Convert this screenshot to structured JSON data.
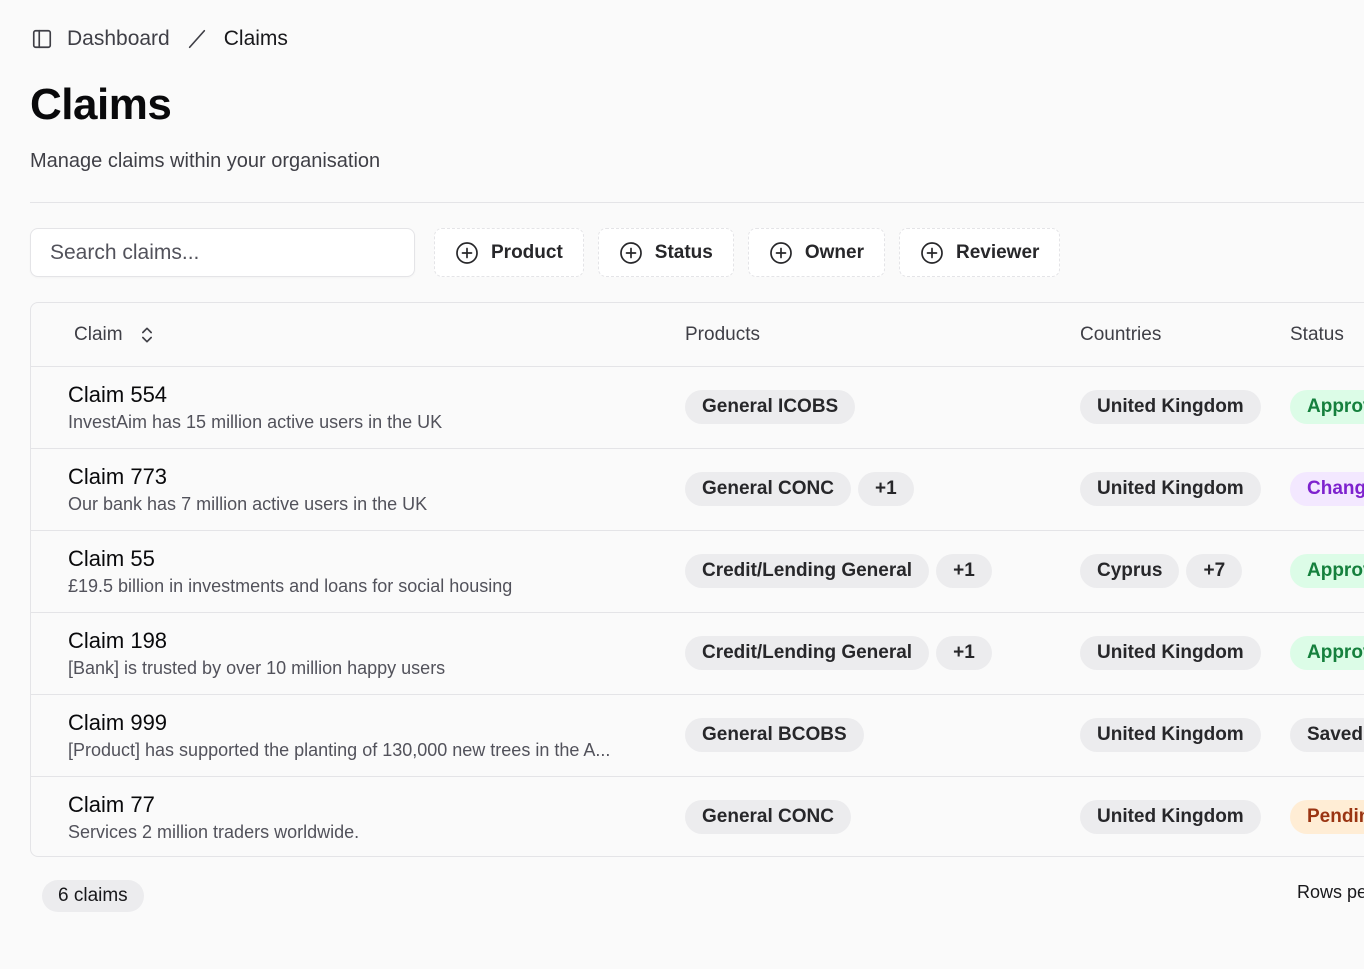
{
  "breadcrumb": {
    "root": "Dashboard",
    "current": "Claims"
  },
  "header": {
    "title": "Claims",
    "subtitle": "Manage claims within your organisation"
  },
  "toolbar": {
    "search_placeholder": "Search claims...",
    "filters": [
      "Product",
      "Status",
      "Owner",
      "Reviewer"
    ]
  },
  "table": {
    "columns": {
      "claim": "Claim",
      "products": "Products",
      "countries": "Countries",
      "status": "Status"
    },
    "rows": [
      {
        "name": "Claim 554",
        "desc": "InvestAim has 15 million active users in the UK",
        "product": "General ICOBS",
        "product_more": "",
        "country": "United Kingdom",
        "country_more": "",
        "status": "Approv",
        "status_bg": "#dcfce7",
        "status_fg": "#15803d"
      },
      {
        "name": "Claim 773",
        "desc": "Our bank has 7 million active users in the UK",
        "product": "General CONC",
        "product_more": "+1",
        "country": "United Kingdom",
        "country_more": "",
        "status": "Chang",
        "status_bg": "#f3e8ff",
        "status_fg": "#7e22ce"
      },
      {
        "name": "Claim 55",
        "desc": "£19.5 billion in investments and loans for social housing",
        "product": "Credit/Lending General",
        "product_more": "+1",
        "country": "Cyprus",
        "country_more": "+7",
        "status": "Approv",
        "status_bg": "#dcfce7",
        "status_fg": "#15803d"
      },
      {
        "name": "Claim 198",
        "desc": "[Bank] is trusted by over 10 million happy users",
        "product": "Credit/Lending General",
        "product_more": "+1",
        "country": "United Kingdom",
        "country_more": "",
        "status": "Approv",
        "status_bg": "#dcfce7",
        "status_fg": "#15803d"
      },
      {
        "name": "Claim 999",
        "desc": "[Product] has supported the planting of 130,000 new trees in the A...",
        "product": "General BCOBS",
        "product_more": "",
        "country": "United Kingdom",
        "country_more": "",
        "status": "Saved",
        "status_bg": "#ececee",
        "status_fg": "#27272a"
      },
      {
        "name": "Claim 77",
        "desc": "Services 2 million traders worldwide.",
        "product": "General CONC",
        "product_more": "",
        "country": "United Kingdom",
        "country_more": "",
        "status": "Pendin",
        "status_bg": "#ffedd5",
        "status_fg": "#9a3412"
      }
    ]
  },
  "footer": {
    "count": "6 claims",
    "rows_per_page": "Rows pe"
  },
  "icons": {
    "sidebar": "sidebar-toggle-icon",
    "separator": "slash-separator-icon",
    "filter": "plus-circle-icon",
    "sort": "chevrons-up-down-icon"
  }
}
